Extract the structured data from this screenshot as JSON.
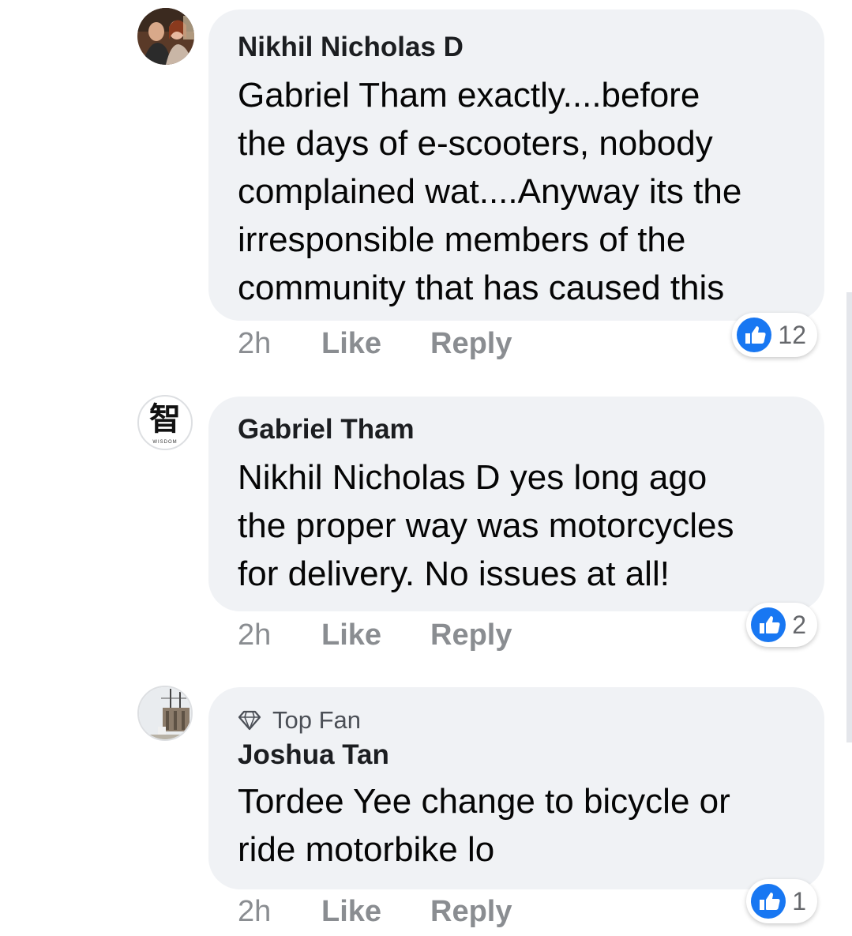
{
  "comments": [
    {
      "author": "Nikhil Nicholas D",
      "lines": [
        "Gabriel Tham exactly....before",
        "the days of e-scooters, nobody",
        "complained wat....Anyway its the",
        "irresponsible members of the",
        "community that has caused this"
      ],
      "time": "2h",
      "like_label": "Like",
      "reply_label": "Reply",
      "reaction_icon": "like-thumb-icon",
      "reaction_count": "12"
    },
    {
      "author": "Gabriel Tham",
      "avatar_glyph": "智",
      "avatar_caption": "WISDOM",
      "lines": [
        "Nikhil Nicholas D yes long ago",
        "the proper way was motorcycles",
        "for delivery. No issues at all!"
      ],
      "time": "2h",
      "like_label": "Like",
      "reply_label": "Reply",
      "reaction_icon": "like-thumb-icon",
      "reaction_count": "2"
    },
    {
      "badge": "Top Fan",
      "badge_icon": "diamond-icon",
      "author": "Joshua Tan",
      "lines": [
        "Tordee Yee change to bicycle or",
        "ride motorbike lo"
      ],
      "time": "2h",
      "like_label": "Like",
      "reply_label": "Reply",
      "reaction_icon": "like-thumb-icon",
      "reaction_count": "1"
    }
  ],
  "colors": {
    "bubble": "#f0f2f5",
    "meta": "#8a8d91",
    "like_blue": "#1877f2"
  }
}
